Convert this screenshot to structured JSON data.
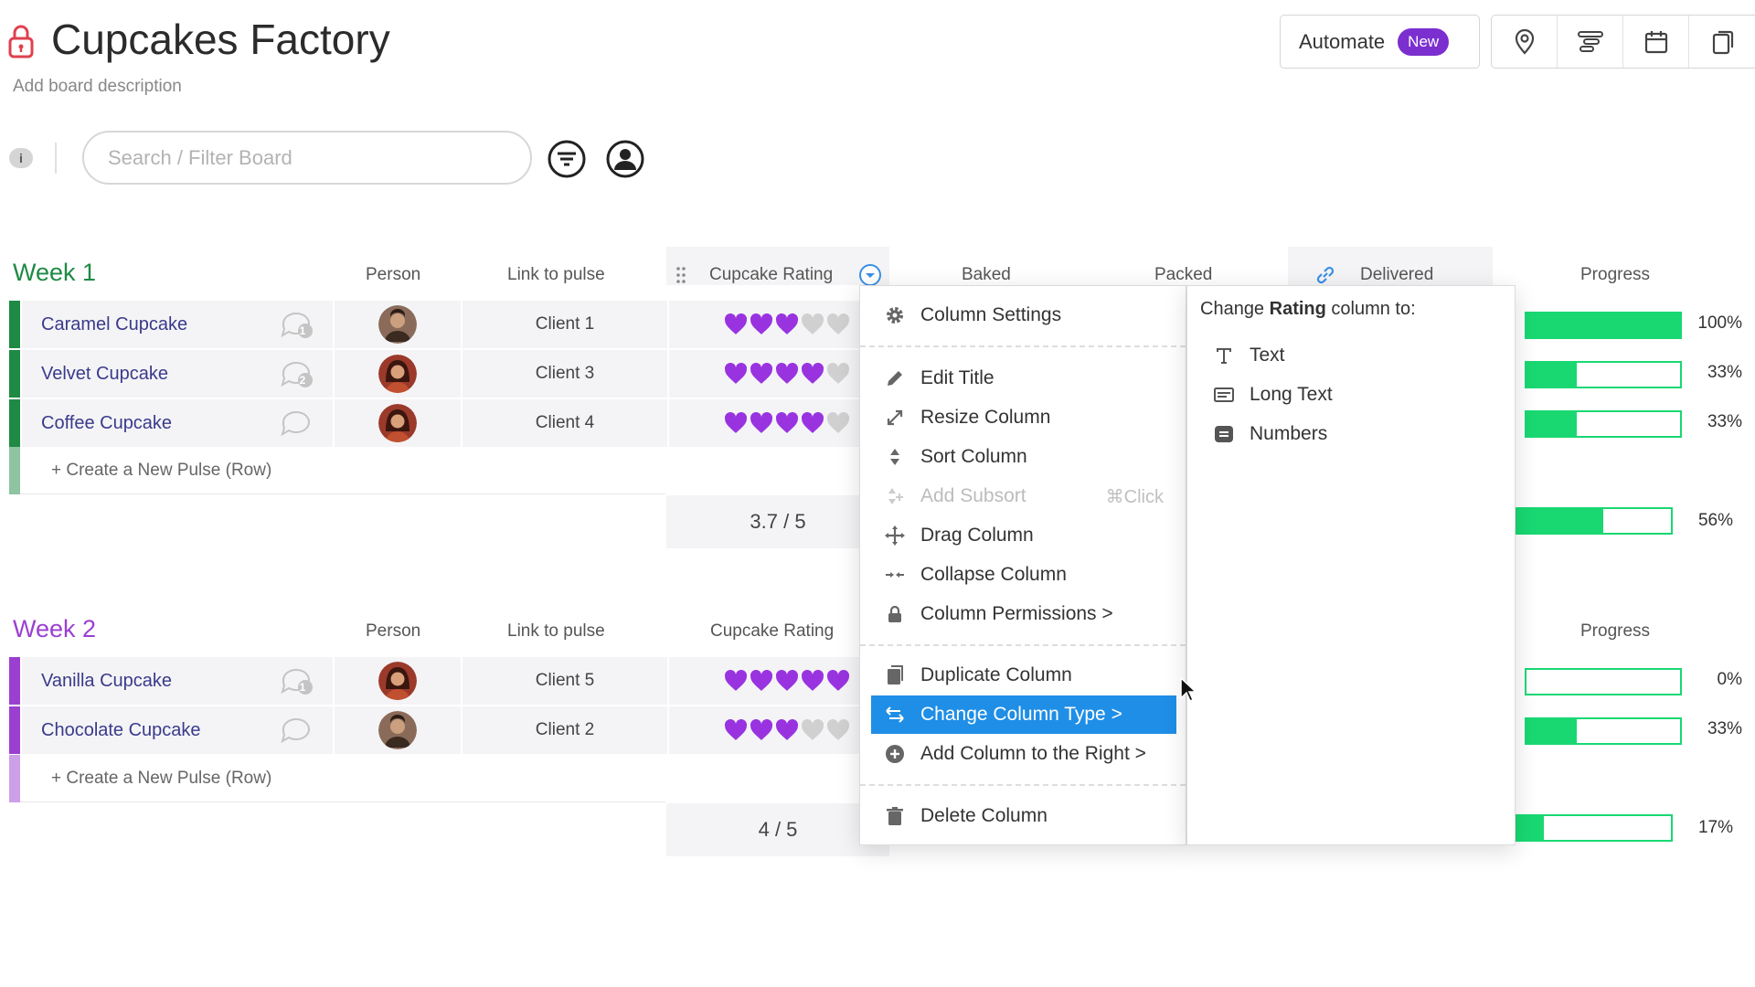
{
  "board": {
    "title": "Cupcakes Factory",
    "description": "Add board description"
  },
  "header": {
    "automate_label": "Automate",
    "new_badge": "New",
    "tools": [
      "map-pin-icon",
      "timeline-icon",
      "calendar-icon",
      "copy-icon"
    ]
  },
  "toolbar": {
    "info_label": "i",
    "search_placeholder": "Search / Filter Board"
  },
  "columns": {
    "person": "Person",
    "link": "Link to pulse",
    "rating": "Cupcake Rating",
    "baked": "Baked",
    "packed": "Packed",
    "delivered": "Delivered",
    "progress": "Progress"
  },
  "colors": {
    "week1": "#1e8a44",
    "week2": "#9b3fd1",
    "heart": "#9933e0",
    "heart_empty": "#d0d0d0",
    "progress": "#19d872",
    "menu_active": "#1f8ee6"
  },
  "groups": [
    {
      "title": "Week 1",
      "new_pulse": "+ Create a New Pulse (Row)",
      "rating_summary": "3.7 / 5",
      "progress_summary": "56%",
      "progress_summary_value": 56,
      "rows": [
        {
          "name": "Caramel Cupcake",
          "updates": "1",
          "avatar": "male",
          "link": "Client 1",
          "rating": 3,
          "progress": "100%",
          "progress_value": 100
        },
        {
          "name": "Velvet Cupcake",
          "updates": "2",
          "avatar": "female",
          "link": "Client 3",
          "rating": 4,
          "progress": "33%",
          "progress_value": 33
        },
        {
          "name": "Coffee Cupcake",
          "updates": "",
          "avatar": "female",
          "link": "Client 4",
          "rating": 4,
          "progress": "33%",
          "progress_value": 33
        }
      ]
    },
    {
      "title": "Week 2",
      "new_pulse": "+ Create a New Pulse (Row)",
      "rating_summary": "4 / 5",
      "progress_summary": "17%",
      "progress_summary_value": 17,
      "rows": [
        {
          "name": "Vanilla Cupcake",
          "updates": "1",
          "avatar": "female",
          "link": "Client 5",
          "rating": 5,
          "progress": "0%",
          "progress_value": 0
        },
        {
          "name": "Chocolate Cupcake",
          "updates": "",
          "avatar": "male",
          "link": "Client 2",
          "rating": 3,
          "progress": "33%",
          "progress_value": 33
        }
      ]
    }
  ],
  "menu": {
    "items": [
      {
        "label": "Column Settings",
        "icon": "gear-icon"
      },
      {
        "label": "Edit Title",
        "icon": "pencil-icon"
      },
      {
        "label": "Resize Column",
        "icon": "resize-icon"
      },
      {
        "label": "Sort Column",
        "icon": "sort-icon"
      },
      {
        "label": "Add Subsort",
        "icon": "subsort-icon",
        "shortcut": "⌘Click",
        "disabled": true
      },
      {
        "label": "Drag Column",
        "icon": "move-icon"
      },
      {
        "label": "Collapse Column",
        "icon": "collapse-icon"
      },
      {
        "label": "Column Permissions >",
        "icon": "lock-icon"
      },
      {
        "label": "Duplicate Column",
        "icon": "duplicate-icon"
      },
      {
        "label": "Change Column Type >",
        "icon": "swap-icon",
        "active": true
      },
      {
        "label": "Add Column to the Right >",
        "icon": "plus-circle-icon"
      },
      {
        "label": "Delete Column",
        "icon": "trash-icon"
      }
    ]
  },
  "submenu": {
    "heading_prefix": "Change ",
    "heading_bold": "Rating",
    "heading_suffix": " column to:",
    "items": [
      {
        "label": "Text",
        "icon": "text-type-icon"
      },
      {
        "label": "Long Text",
        "icon": "long-text-icon"
      },
      {
        "label": "Numbers",
        "icon": "numbers-icon"
      }
    ]
  }
}
